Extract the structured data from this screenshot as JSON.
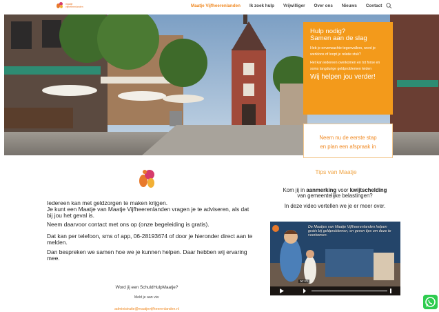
{
  "header": {
    "logo_line1": "maatje",
    "logo_line2": "vijfheerenlanden",
    "nav": [
      "Maatje Vijfheerenlanden",
      "Ik zoek hulp",
      "Vrijwilliger",
      "Over ons",
      "Nieuws",
      "Contact"
    ],
    "search_icon": "search-icon"
  },
  "hero": {
    "box_title_1": "Hulp nodig?",
    "box_title_2": "Samen aan de slag",
    "box_small_1": "Heb je onverwachte tegenvallers, word je werkloos of loopt je relatie stuk?",
    "box_small_2": "Het kan iedereen overkomen en tot forse en soms langdurige geldproblemen leiden",
    "box_big": "Wij helpen jou verder!",
    "cta_line1": "Neem nu de eerste stap",
    "cta_line2": "en plan een afspraak in"
  },
  "left": {
    "p1": "Iedereen kan met geldzorgen te maken krijgen.",
    "p2": "Je kunt een Maatje van Maatje Vijfheerenlanden vragen je te adviseren, als dat bij jou het geval is.",
    "p3": "Neem daarvoor contact met ons op (onze begeleiding is gratis).",
    "p4": "Dat kan per telefoon, sms of app, 06-28193674 of door je hieronder direct aan te melden.",
    "p5": "Dan bespreken we samen hoe we je kunnen helpen. Daar hebben wij ervaring mee.",
    "question": "Word jij een SchuldHulpMaatje?",
    "signup": "Meld je aan via:",
    "email": "administratie@maatjevijfheerenlanden.nl"
  },
  "right": {
    "title": "Tips van Maatje",
    "text1_a": "Kom jij in ",
    "text1_b": "aanmerking",
    "text1_c": " voor ",
    "text1_d": "kwijtschelding",
    "text1_e": "van gemeentelijke belastingen?",
    "text2": "In deze video vertellen we je er meer over.",
    "video_caption": "De Maatjes van Maatje Vijfheerenlanden helpen gratis bij geldproblemen, en geven tips om deze te voorkomen.",
    "video_time": "00:03"
  },
  "colors": {
    "accent": "#f08a24",
    "box": "#f39a1b",
    "whatsapp": "#2ecc4f"
  }
}
